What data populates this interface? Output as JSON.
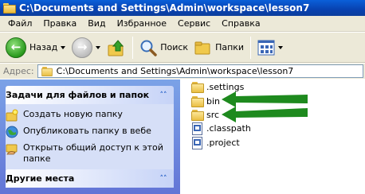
{
  "window": {
    "title": "C:\\Documents and Settings\\Admin\\workspace\\lesson7"
  },
  "menu": [
    "Файл",
    "Правка",
    "Вид",
    "Избранное",
    "Сервис",
    "Справка"
  ],
  "toolbar": {
    "back": "Назад",
    "search": "Поиск",
    "folders": "Папки"
  },
  "address": {
    "label": "Адрес:",
    "path": "C:\\Documents and Settings\\Admin\\workspace\\lesson7"
  },
  "tasks_panel": {
    "title": "Задачи для файлов и папок",
    "items": [
      "Создать новую папку",
      "Опубликовать папку в вебе",
      "Открыть общий доступ к этой папке"
    ]
  },
  "other_places": {
    "title": "Другие места"
  },
  "files": [
    {
      "name": ".settings",
      "type": "folder"
    },
    {
      "name": "bin",
      "type": "folder"
    },
    {
      "name": "src",
      "type": "folder"
    },
    {
      "name": ".classpath",
      "type": "document"
    },
    {
      "name": ".project",
      "type": "document"
    }
  ],
  "colors": {
    "titlebar": "#0a5fd9",
    "taskpane": "#7ba2e7",
    "annotation_arrow": "#1e8a1e"
  }
}
